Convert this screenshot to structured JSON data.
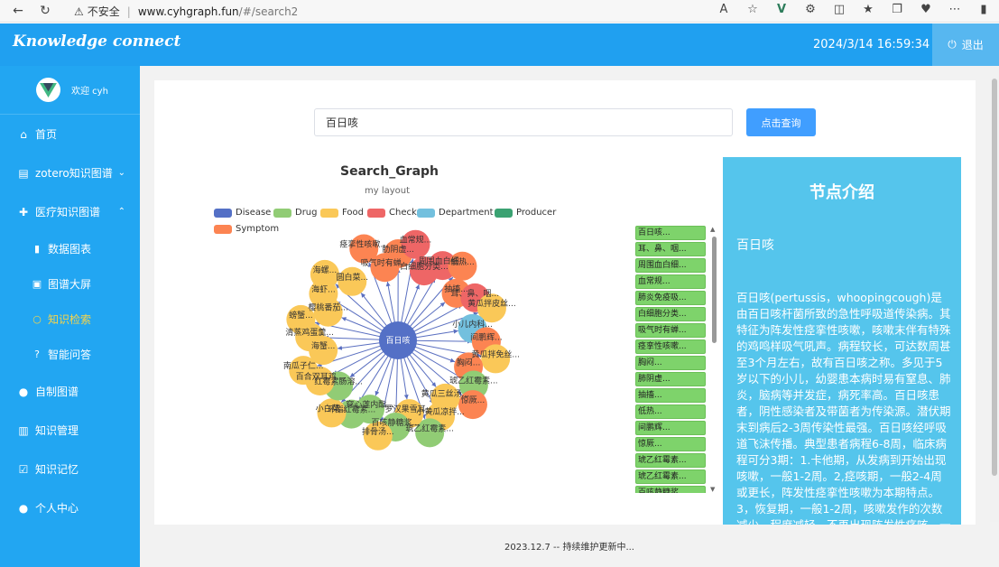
{
  "browser": {
    "insecure_label": "不安全",
    "url_host": "www.cyhgraph.fun",
    "url_path": "/#/search2"
  },
  "header": {
    "brand": "Knowledge connect",
    "datetime": "2024/3/14 16:59:34",
    "logout_label": "退出"
  },
  "sidebar": {
    "welcome": "欢迎 cyh",
    "items": [
      {
        "label": "首页",
        "icon": "home-icon"
      },
      {
        "label": "zotero知识图谱",
        "icon": "clipboard-icon"
      },
      {
        "label": "医疗知识图谱",
        "icon": "medical-kit-icon"
      },
      {
        "label": "数据图表",
        "icon": "bar-chart-icon"
      },
      {
        "label": "图谱大屏",
        "icon": "image-icon"
      },
      {
        "label": "知识检索",
        "icon": "search-icon"
      },
      {
        "label": "智能问答",
        "icon": "question-icon"
      },
      {
        "label": "自制图谱",
        "icon": "location-icon"
      },
      {
        "label": "知识管理",
        "icon": "book-icon"
      },
      {
        "label": "知识记忆",
        "icon": "checklist-icon"
      },
      {
        "label": "个人中心",
        "icon": "user-icon"
      }
    ]
  },
  "search": {
    "value": "百日咳",
    "button_label": "点击查询"
  },
  "graph": {
    "title": "Search_Graph",
    "subtitle": "my layout",
    "legend": [
      {
        "label": "Disease",
        "color": "#5470c6"
      },
      {
        "label": "Drug",
        "color": "#91cc75"
      },
      {
        "label": "Food",
        "color": "#fac858"
      },
      {
        "label": "Check",
        "color": "#ee6666"
      },
      {
        "label": "Department",
        "color": "#73c0de"
      },
      {
        "label": "Producer",
        "color": "#3ba272"
      },
      {
        "label": "Symptom",
        "color": "#fc8452"
      }
    ],
    "center_label": "百日咳",
    "nodes": [
      {
        "label": "痉挛性咳嗽...",
        "cat": "Symptom"
      },
      {
        "label": "吸气时有蝉...",
        "cat": "Symptom"
      },
      {
        "label": "肋阴虚...",
        "cat": "Symptom"
      },
      {
        "label": "血常规...",
        "cat": "Check"
      },
      {
        "label": "白细胞分类...",
        "cat": "Check"
      },
      {
        "label": "周围血白细...",
        "cat": "Check"
      },
      {
        "label": "低热...",
        "cat": "Symptom"
      },
      {
        "label": "抽搐...",
        "cat": "Symptom"
      },
      {
        "label": "耳、鼻、咽...",
        "cat": "Check"
      },
      {
        "label": "黄瓜拌皮丝...",
        "cat": "Food"
      },
      {
        "label": "小儿内科...",
        "cat": "Department"
      },
      {
        "label": "间鹏辉...",
        "cat": "Symptom"
      },
      {
        "label": "黄瓜拌免丝...",
        "cat": "Food"
      },
      {
        "label": "胸闷...",
        "cat": "Symptom"
      },
      {
        "label": "琥乙红霉素...",
        "cat": "Drug"
      },
      {
        "label": "惊厥...",
        "cat": "Symptom"
      },
      {
        "label": "黄瓜三丝汤...",
        "cat": "Food"
      },
      {
        "label": "小黄瓜凉拌...",
        "cat": "Food"
      },
      {
        "label": "琥乙红霉素...",
        "cat": "Drug"
      },
      {
        "label": "罗汉果雪耳...",
        "cat": "Food"
      },
      {
        "label": "百咳静糖浆...",
        "cat": "Drug"
      },
      {
        "label": "排骨汤...",
        "cat": "Food"
      },
      {
        "label": "穿心莲内酯...",
        "cat": "Drug"
      },
      {
        "label": "环酯红霉素...",
        "cat": "Drug"
      },
      {
        "label": "小白菜...",
        "cat": "Food"
      },
      {
        "label": "红霉素肠溶...",
        "cat": "Drug"
      },
      {
        "label": "百合双耳鸡...",
        "cat": "Food"
      },
      {
        "label": "南瓜子仁...",
        "cat": "Food"
      },
      {
        "label": "海蟹...",
        "cat": "Food"
      },
      {
        "label": "清蒸鸡蛋羹...",
        "cat": "Food"
      },
      {
        "label": "螃蟹...",
        "cat": "Food"
      },
      {
        "label": "樱桃番茄...",
        "cat": "Food"
      },
      {
        "label": "海虾...",
        "cat": "Food"
      },
      {
        "label": "海螺...",
        "cat": "Food"
      },
      {
        "label": "圆白菜...",
        "cat": "Food"
      }
    ]
  },
  "node_list": [
    "百日咳...",
    "耳、鼻、咽...",
    "周围血白细...",
    "血常规...",
    "肺炎免疫吸...",
    "白细胞分类...",
    "吸气时有蝉...",
    "痉挛性咳嗽...",
    "胸闷...",
    "肺阴虚...",
    "抽搐...",
    "低热...",
    "间鹏辉...",
    "惊厥...",
    "琥乙红霉素...",
    "琥乙红霉素...",
    "百咳静糖浆..."
  ],
  "intro": {
    "title": "节点介绍",
    "name": "百日咳",
    "description": "百日咳(pertussis，whoopingcough)是由百日咳杆菌所致的急性呼吸道传染病。其特征为阵发性痉挛性咳嗽，咳嗽末伴有特殊的鸡鸣样吸气吼声。病程较长，可达数周甚至3个月左右，故有百日咳之称。多见于5岁以下的小儿，幼婴患本病时易有窒息、肺炎，脑病等并发症，病死率高。百日咳患者，阴性感染者及带菌者为传染源。潜伏期末到病后2-3周传染性最强。百日咳经呼吸道飞沫传播。典型患者病程6-8周，临床病程可分3期：1.卡他期，从发病到开始出现咳嗽，一般1-2周。2,痉咳期，一般2-4周或更长，阵发性痉挛性咳嗽为本期特点。3，恢复期，一般1-2周，咳嗽发作的次数减少，程度减轻，不再出现阵发性痉咳。一般外周血白细胞计数明显增"
  },
  "footer": {
    "text": "2023.12.7 -- 持续维护更新中..."
  }
}
